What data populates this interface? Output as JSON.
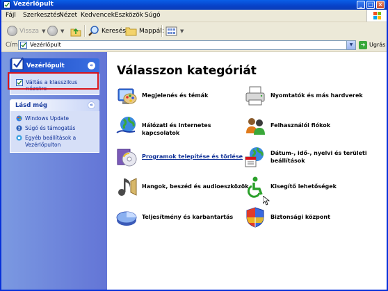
{
  "window": {
    "title": "Vezérlőpult"
  },
  "menu": [
    "Fájl",
    "Szerkesztés",
    "Nézet",
    "Kedvencek",
    "Eszközök",
    "Súgó"
  ],
  "toolbar": {
    "back": "Vissza",
    "search": "Keresés",
    "folders": "Mappák"
  },
  "address": {
    "label": "Cím",
    "value": "Vezérlőpult",
    "go": "Ugrás"
  },
  "sidebar": {
    "panel_title": "Vezérlőpult",
    "switch_view": "Váltás a klasszikus nézetre",
    "see_also_title": "Lásd még",
    "see_also": [
      "Windows Update",
      "Súgó és támogatás",
      "Egyéb beállítások a Vezérlőpulton"
    ]
  },
  "main": {
    "title": "Válasszon kategóriát",
    "categories": [
      "Megjelenés és témák",
      "Nyomtatók és más hardverek",
      "Hálózati és internetes kapcsolatok",
      "Felhasználói fiókok",
      "Programok telepítése és törlése",
      "Dátum-, idő-, nyelvi és területi beállítások",
      "Hangok, beszéd és audioeszközök",
      "Kisegítő lehetőségek",
      "Teljesítmény és karbantartás",
      "Biztonsági központ"
    ]
  },
  "colors": {
    "title_bar": "#0a4fd8",
    "sidebar": "#6f87dc",
    "highlight": "#d9141b",
    "link": "#0c2e96"
  }
}
